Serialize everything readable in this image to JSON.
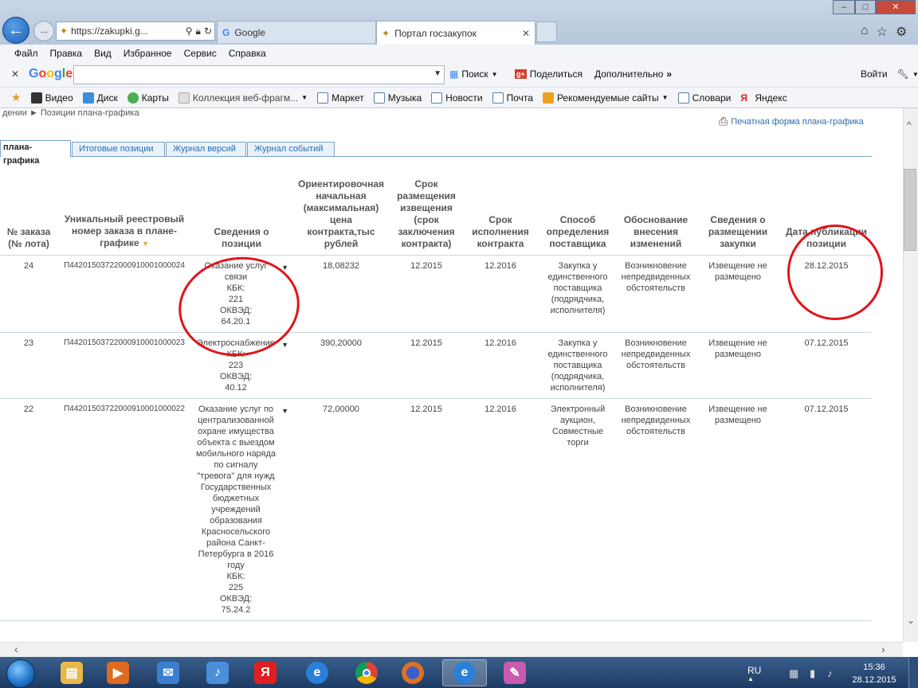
{
  "browser": {
    "address": "https://zakupki.g...",
    "tabs": [
      {
        "label": "Google"
      },
      {
        "label": "Портал госзакупок"
      }
    ],
    "menu": [
      "Файл",
      "Правка",
      "Вид",
      "Избранное",
      "Сервис",
      "Справка"
    ],
    "google_toolbar": {
      "logo": "Google",
      "search_value": "",
      "search_label": "Поиск",
      "share_label": "Поделиться",
      "more_label": "Дополнительно",
      "signin_label": "Войти"
    },
    "favorites": [
      {
        "label": "Видео",
        "color": "#333333"
      },
      {
        "label": "Диск",
        "color": "#3a8fd8"
      },
      {
        "label": "Карты",
        "color": "#4caf50"
      },
      {
        "label": "Коллекция веб-фрагм...",
        "color": "#e0e0e0"
      },
      {
        "label": "Маркет",
        "color": "#5b7fb0"
      },
      {
        "label": "Музыка",
        "color": "#5b7fb0"
      },
      {
        "label": "Новости",
        "color": "#5b7fb0"
      },
      {
        "label": "Почта",
        "color": "#5b7fb0"
      },
      {
        "label": "Рекомендуемые сайты",
        "color": "#f0a020"
      },
      {
        "label": "Словари",
        "color": "#5b7fb0"
      },
      {
        "label": "Яндекс",
        "color": "#e02020"
      }
    ]
  },
  "page": {
    "breadcrumb": "дении  ►  Позиции плана-графика",
    "print_link": "Печатная форма плана-графика",
    "tabs": [
      {
        "label": "плана-графика",
        "active": true
      },
      {
        "label": "Итоговые позиции"
      },
      {
        "label": "Журнал версий"
      },
      {
        "label": "Журнал событий"
      }
    ],
    "table": {
      "headers": [
        "№ заказа (№ лота)",
        "Уникальный реестровый номер заказа в плане-графике",
        "Сведения о позиции",
        "Ориентировочная начальная (максимальная) цена контракта,тыс рублей",
        "Срок размещения извещения (срок заключения контракта)",
        "Срок исполнения контракта",
        "Способ определения поставщика",
        "Обоснование внесения изменений",
        "Сведения о размещении закупки",
        "Дата публикации позиции"
      ],
      "rows": [
        {
          "num": "24",
          "reg": "П44201503722000910001000024",
          "pos": "Оказание услуг связи\nКБК:\n221\nОКВЭД:\n64.20.1",
          "price": "18,08232",
          "place_term": "12.2015",
          "exec_term": "12.2016",
          "method": "Закупка у единственного поставщика (подрядчика, исполнителя)",
          "reason": "Возникновение непредвиденных обстоятельств",
          "status": "Извещение не размещено",
          "date": "28.12.2015"
        },
        {
          "num": "23",
          "reg": "П44201503722000910001000023",
          "pos": "Электроснабжение\nКБК:\n223\nОКВЭД:\n40.12",
          "price": "390,20000",
          "place_term": "12.2015",
          "exec_term": "12.2016",
          "method": "Закупка у единственного поставщика (подрядчика, исполнителя)",
          "reason": "Возникновение непредвиденных обстоятельств",
          "status": "Извещение не размещено",
          "date": "07.12.2015"
        },
        {
          "num": "22",
          "reg": "П44201503722000910001000022",
          "pos": "Оказание услуг по централизованной охране имущества объекта с выездом мобильного наряда по сигналу \"тревога\" для нужд Государственных бюджетных учреждений образования Красносельского района Санкт-Петербурга в 2016 году\nКБК:\n225\nОКВЭД:\n75.24.2",
          "price": "72,00000",
          "place_term": "12.2015",
          "exec_term": "12.2016",
          "method": "Электронный аукцион, Совместные торги",
          "reason": "Возникновение непредвиденных обстоятельств",
          "status": "Извещение не размещено",
          "date": "07.12.2015"
        }
      ]
    }
  },
  "taskbar": {
    "apps": [
      {
        "name": "explorer",
        "color": "#e8b84a",
        "glyph": "▤"
      },
      {
        "name": "media",
        "color": "#e06a20",
        "glyph": "▶"
      },
      {
        "name": "mail",
        "color": "#3c7fd0",
        "glyph": "✉"
      },
      {
        "name": "audio",
        "color": "#4a8fd8",
        "glyph": "♪"
      },
      {
        "name": "yandex",
        "color": "#e02020",
        "glyph": "Я"
      },
      {
        "name": "ie",
        "color": "#2a7fd8",
        "glyph": "e"
      },
      {
        "name": "chrome",
        "color": "#3a9c3a",
        "glyph": "●"
      },
      {
        "name": "firefox",
        "color": "#e07020",
        "glyph": "●"
      },
      {
        "name": "ie-active",
        "color": "#2a7fd8",
        "glyph": "e"
      },
      {
        "name": "paint",
        "color": "#c85ab0",
        "glyph": "✎"
      }
    ],
    "lang": "RU",
    "time": "15:36",
    "date": "28.12.2015"
  },
  "colors": {
    "annotation": "#e1141b",
    "link": "#2a6eb0"
  }
}
